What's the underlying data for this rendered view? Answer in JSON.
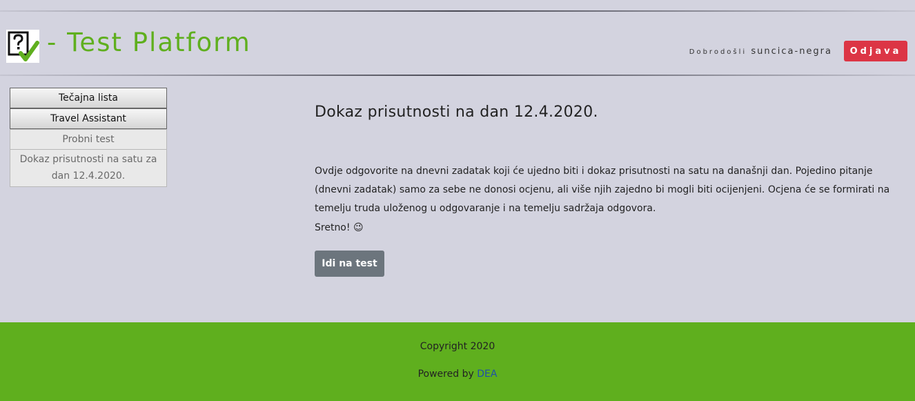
{
  "header": {
    "brand_title": "- Test Platform",
    "welcome_label": "Dobrodošli",
    "username": "suncica-negra",
    "logout_label": "Odjava",
    "brand_color": "#5faf1e",
    "logout_color": "#dc3545"
  },
  "sidebar": {
    "items": [
      {
        "label": "Tečajna lista"
      },
      {
        "label": "Travel Assistant"
      },
      {
        "label": "Probni test"
      },
      {
        "label": "Dokaz prisutnosti na satu za dan 12.4.2020."
      }
    ]
  },
  "main": {
    "title": "Dokaz prisutnosti na dan 12.4.2020.",
    "description": "Ovdje odgovorite na dnevni zadatak koji će ujedno biti i dokaz prisutnosti na satu na današnji dan. Pojedino pitanje (dnevni zadatak) samo za sebe ne donosi ocjenu, ali više njih zajedno bi mogli biti ocijenjeni. Ocjena će se formirati na temelju truda uloženog u odgovaranje i na temelju sadržaja odgovora.",
    "closing_text": "Sretno!",
    "closing_emoji": "😉",
    "go_button_label": "Idi na test",
    "go_button_color": "#6c757d"
  },
  "footer": {
    "copyright": "Copyright 2020",
    "powered_prefix": "Powered by",
    "powered_link": "DEA",
    "footer_color": "#5faf1e"
  }
}
